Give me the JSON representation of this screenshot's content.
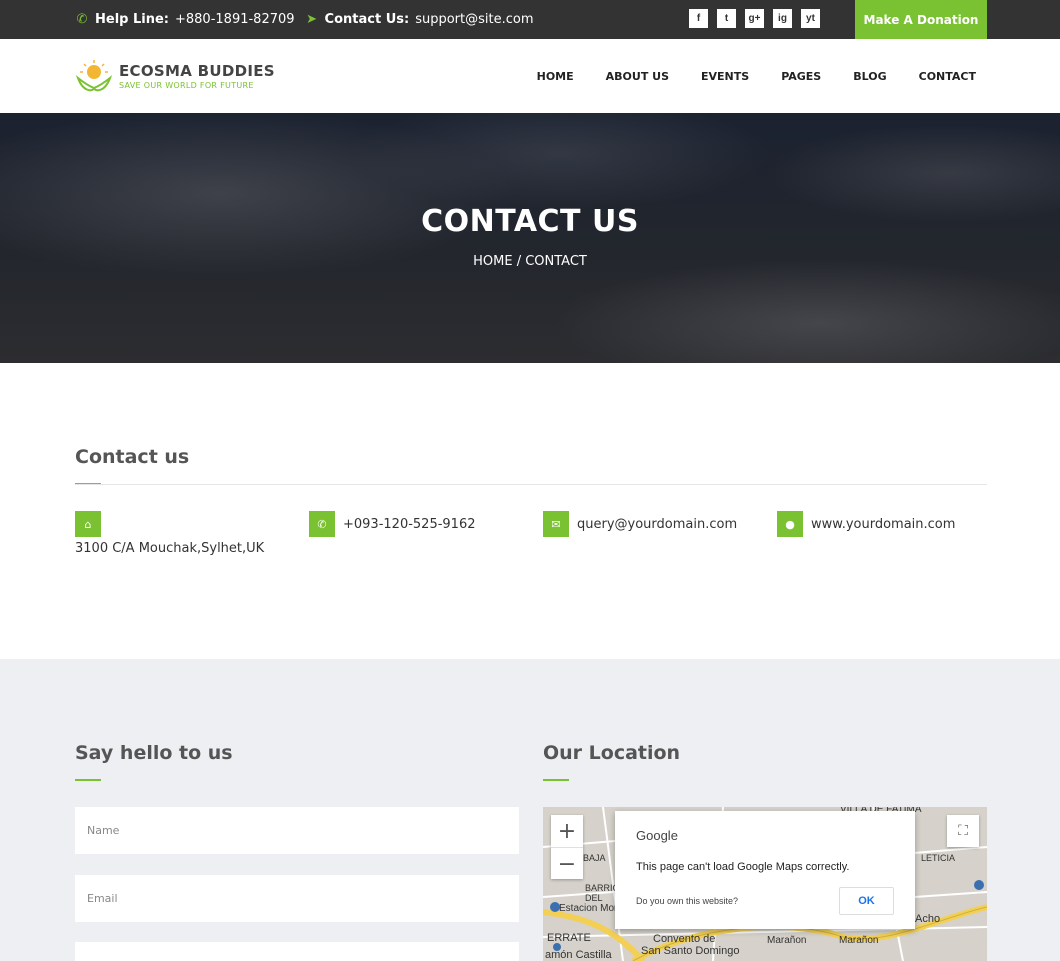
{
  "topbar": {
    "help_label": "Help Line:",
    "help_number": "+880-1891-82709",
    "contact_label": "Contact Us:",
    "contact_email": "support@site.com",
    "social": [
      "f",
      "t",
      "g+",
      "ig",
      "yt"
    ],
    "donate_label": "Make A Donation"
  },
  "logo": {
    "name": "ECOSMA BUDDIES",
    "tagline": "SAVE OUR WORLD FOR FUTURE"
  },
  "nav": {
    "items": [
      "HOME",
      "ABOUT US",
      "EVENTS",
      "PAGES",
      "BLOG",
      "CONTACT"
    ]
  },
  "hero": {
    "title": "CONTACT US",
    "breadcrumb": "HOME / CONTACT"
  },
  "contact_info": {
    "title": "Contact us",
    "address": "3100 C/A Mouchak,Sylhet,UK",
    "phone": "+093-120-525-9162",
    "email": "query@yourdomain.com",
    "website": "www.yourdomain.com"
  },
  "form": {
    "title": "Say hello to us",
    "name_placeholder": "Name",
    "email_placeholder": "Email"
  },
  "location": {
    "title": "Our Location",
    "dialog": {
      "brand": "Google",
      "message": "This page can't load Google Maps correctly.",
      "question": "Do you own this website?",
      "ok": "OK"
    },
    "labels": {
      "villa": "VILLA DE FATIMA",
      "leticia": "LETICIA",
      "baja": "BAJA",
      "barrio": "BARRIO",
      "del": "DEL",
      "estacion": "Estacion Mor",
      "errate": "ERRATE",
      "convento": "Convento de",
      "santo": "San Santo Domingo",
      "castilla": "amón Castilla",
      "maranon1": "Marañon",
      "maranon2": "Marañon",
      "acho": "Acho"
    }
  },
  "colors": {
    "accent": "#7ac231",
    "topbar": "#333333",
    "lower_bg": "#edeff2"
  }
}
